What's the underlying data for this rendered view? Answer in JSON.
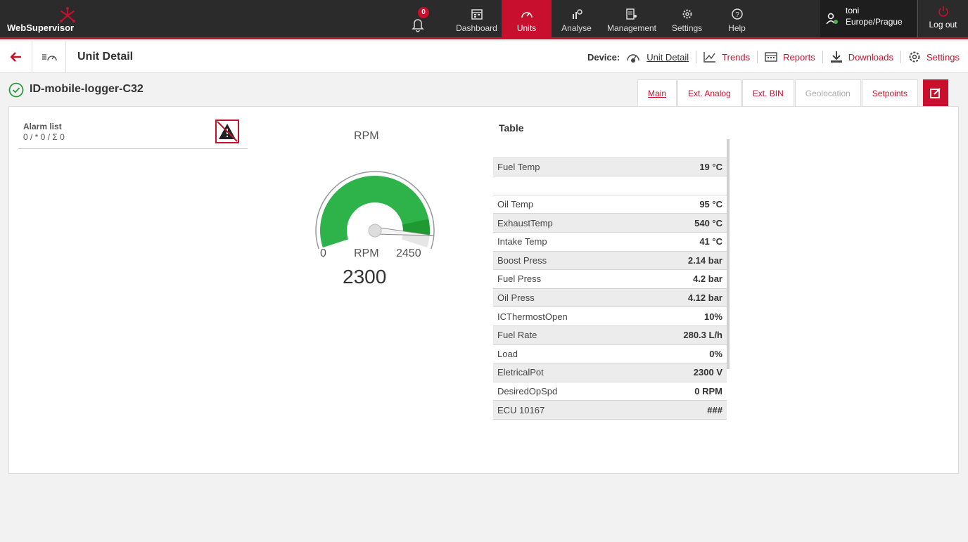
{
  "app": {
    "name": "WebSupervisor",
    "brand_color": "#c8102e"
  },
  "notifications": {
    "count": "0"
  },
  "nav": {
    "items": [
      {
        "label": "Dashboard",
        "icon": "dashboard-icon"
      },
      {
        "label": "Units",
        "icon": "units-gauge-icon",
        "active": true
      },
      {
        "label": "Analyse",
        "icon": "analyse-icon"
      },
      {
        "label": "Management",
        "icon": "management-icon"
      },
      {
        "label": "Settings",
        "icon": "gear-icon"
      },
      {
        "label": "Help",
        "icon": "help-icon"
      }
    ]
  },
  "user": {
    "name": "toni",
    "timezone": "Europe/Prague"
  },
  "logout": {
    "label": "Log out"
  },
  "subbar": {
    "title": "Unit Detail",
    "device_label": "Device:",
    "links": [
      {
        "label": "Unit Detail",
        "icon": "gauge-icon"
      },
      {
        "label": "Trends",
        "icon": "trend-icon"
      },
      {
        "label": "Reports",
        "icon": "reports-icon"
      },
      {
        "label": "Downloads",
        "icon": "download-icon"
      },
      {
        "label": "Settings",
        "icon": "gear-icon"
      }
    ]
  },
  "unit": {
    "name": "ID-mobile-logger-C32",
    "status": "ok"
  },
  "tabs": [
    {
      "label": "Main",
      "active": true
    },
    {
      "label": "Ext. Analog"
    },
    {
      "label": "Ext. BIN"
    },
    {
      "label": "Geolocation",
      "disabled": true
    },
    {
      "label": "Setpoints"
    }
  ],
  "alarm": {
    "title": "Alarm list",
    "count": "0 / * 0 / Σ 0"
  },
  "gauge": {
    "title": "RPM",
    "unit": "RPM",
    "min": "0",
    "max": "2450",
    "value": "2300",
    "fraction": 0.939
  },
  "table": {
    "title": "Table",
    "rows": [
      {
        "label": "",
        "value": ""
      },
      {
        "label": "Fuel Temp",
        "value": "19 °C"
      },
      {
        "label": "",
        "value": ""
      },
      {
        "label": "Oil Temp",
        "value": "95 °C"
      },
      {
        "label": "ExhaustTemp",
        "value": "540 °C"
      },
      {
        "label": "Intake Temp",
        "value": "41 °C"
      },
      {
        "label": "Boost Press",
        "value": "2.14 bar"
      },
      {
        "label": "Fuel Press",
        "value": "4.2 bar"
      },
      {
        "label": "Oil Press",
        "value": "4.12 bar"
      },
      {
        "label": "ICThermostOpen",
        "value": "10%"
      },
      {
        "label": "Fuel Rate",
        "value": "280.3 L/h"
      },
      {
        "label": "Load",
        "value": "0%"
      },
      {
        "label": "EletricalPot",
        "value": "2300 V"
      },
      {
        "label": "DesiredOpSpd",
        "value": "0 RPM"
      },
      {
        "label": "ECU 10167",
        "value": "###"
      }
    ]
  }
}
